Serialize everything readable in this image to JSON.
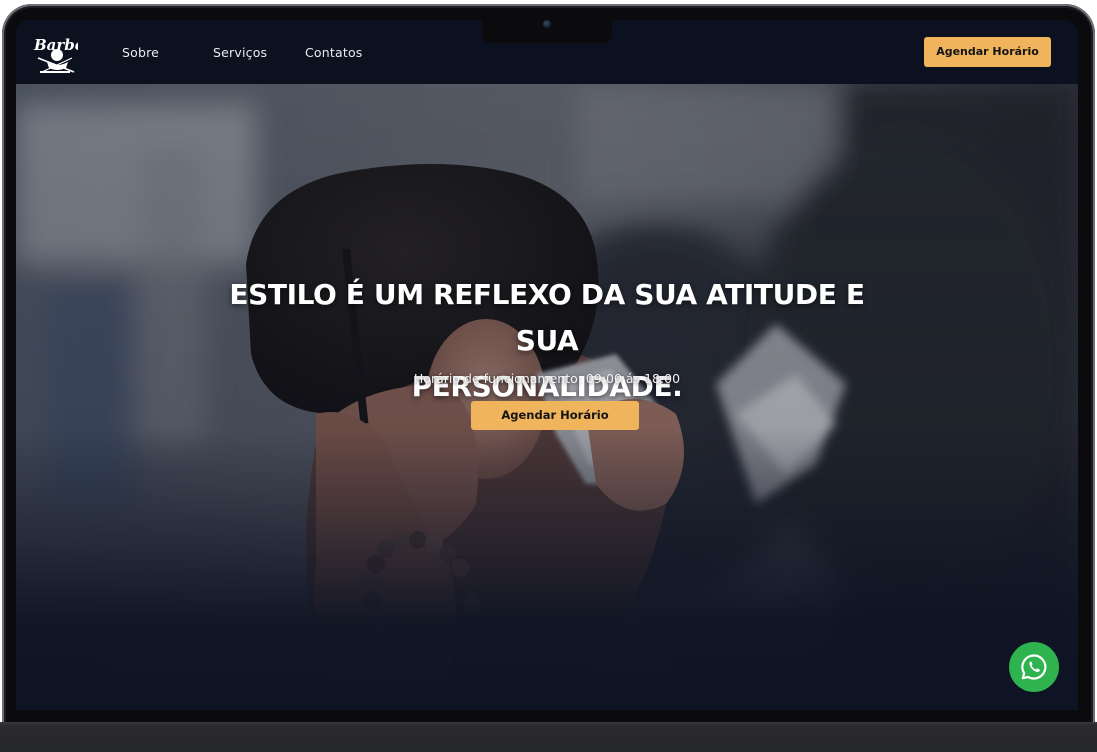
{
  "nav": {
    "logo_text": "Barber",
    "links": [
      {
        "label": "Sobre"
      },
      {
        "label": "Serviços"
      },
      {
        "label": "Contatos"
      }
    ],
    "cta_label": "Agendar Horário"
  },
  "hero": {
    "title_line1": "ESTILO É UM REFLEXO DA SUA ATITUDE E SUA",
    "title_line2": "PERSONALIDADE.",
    "hours_text": "Horário de funcionamento: 09:00 ás 18:00",
    "cta_label": "Agendar Horário"
  },
  "floating": {
    "whatsapp_icon": "whatsapp-icon"
  },
  "colors": {
    "accent": "#f0b45c",
    "navbar": "#0c1120",
    "background": "#0f1424",
    "whatsapp": "#2fb34f"
  }
}
